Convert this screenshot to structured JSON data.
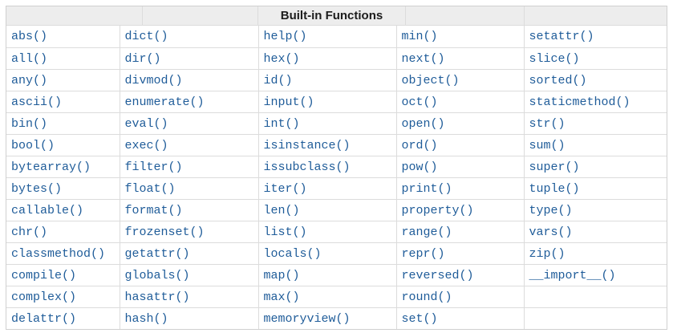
{
  "page": {
    "background": "#ffffff"
  },
  "table": {
    "header": {
      "title": "Built-in Functions"
    },
    "columns": [
      [
        "abs()",
        "all()",
        "any()",
        "ascii()",
        "bin()",
        "bool()",
        "bytearray()",
        "bytes()",
        "callable()",
        "chr()",
        "classmethod()",
        "compile()",
        "complex()",
        "delattr()"
      ],
      [
        "dict()",
        "dir()",
        "divmod()",
        "enumerate()",
        "eval()",
        "exec()",
        "filter()",
        "float()",
        "format()",
        "frozenset()",
        "getattr()",
        "globals()",
        "hasattr()",
        "hash()"
      ],
      [
        "help()",
        "hex()",
        "id()",
        "input()",
        "int()",
        "isinstance()",
        "issubclass()",
        "iter()",
        "len()",
        "list()",
        "locals()",
        "map()",
        "max()",
        "memoryview()"
      ],
      [
        "min()",
        "next()",
        "object()",
        "oct()",
        "open()",
        "ord()",
        "pow()",
        "print()",
        "property()",
        "range()",
        "repr()",
        "reversed()",
        "round()",
        "set()"
      ],
      [
        "setattr()",
        "slice()",
        "sorted()",
        "staticmethod()",
        "str()",
        "sum()",
        "super()",
        "tuple()",
        "type()",
        "vars()",
        "zip()",
        "__import__()",
        "",
        ""
      ]
    ],
    "colors": {
      "link": "#1f5c99",
      "header_bg": "#ededed",
      "header_text": "#1c1c1c",
      "border_inner": "#dcdcdc",
      "border_outer": "#d0d0d0"
    }
  }
}
